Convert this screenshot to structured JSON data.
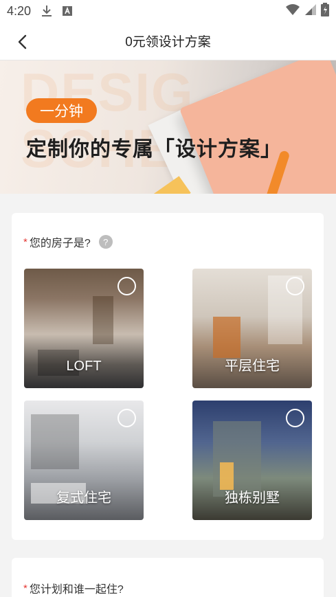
{
  "status_bar": {
    "time": "4:20"
  },
  "app_bar": {
    "title": "0元领设计方案"
  },
  "banner": {
    "ghost_text_1": "DESIG",
    "ghost_text_2": "SCHE",
    "tag": "一分钟",
    "headline": "定制你的专属「设计方案」"
  },
  "question1": {
    "required_mark": "*",
    "label": "您的房子是?",
    "help": "?",
    "options": [
      {
        "label": "LOFT"
      },
      {
        "label": "平层住宅"
      },
      {
        "label": "复式住宅"
      },
      {
        "label": "独栋别墅"
      }
    ]
  },
  "question2": {
    "required_mark": "*",
    "label": "您计划和谁一起住?"
  }
}
